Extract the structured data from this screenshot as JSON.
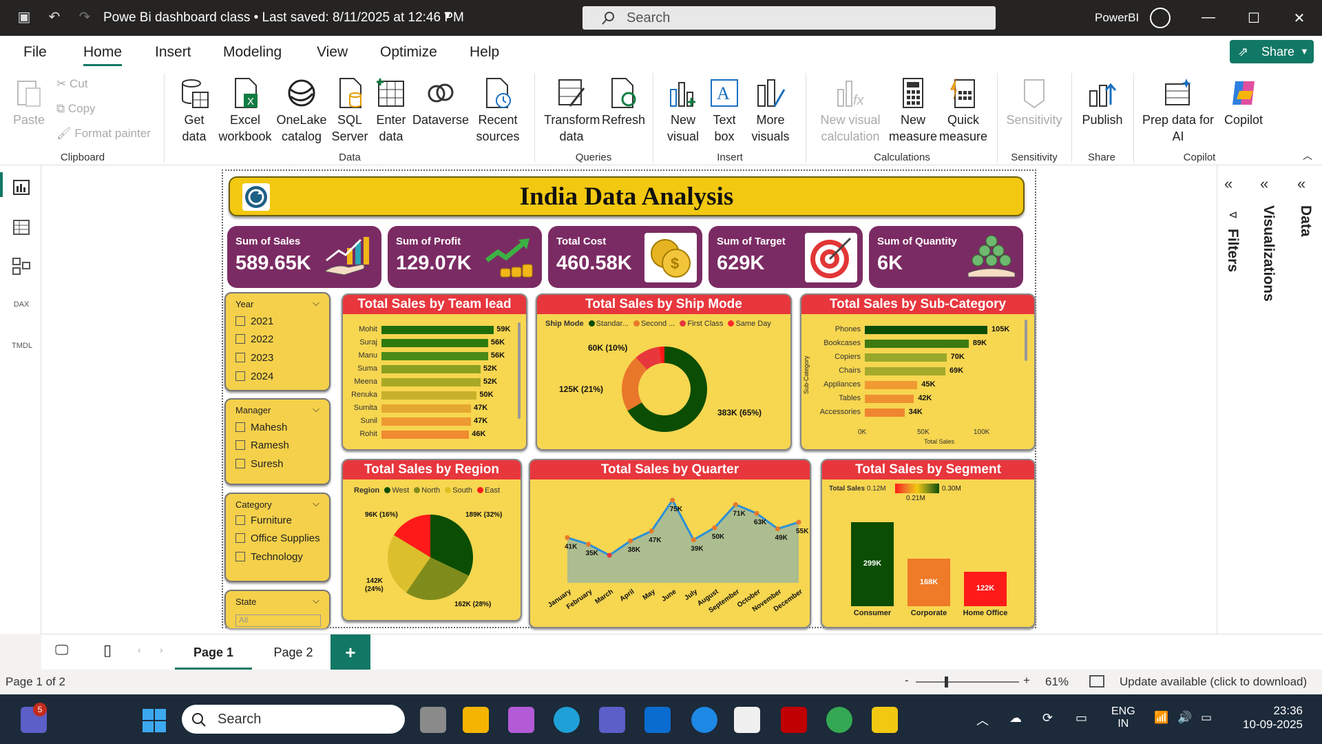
{
  "titlebar": {
    "doc_title": "Powe Bi dashboard class • Last saved: 8/11/2025 at 12:46 PM",
    "search_placeholder": "Search",
    "app_name": "PowerBI"
  },
  "menu": {
    "file": "File",
    "home": "Home",
    "insert": "Insert",
    "modeling": "Modeling",
    "view": "View",
    "optimize": "Optimize",
    "help": "Help",
    "share": "Share"
  },
  "ribbon": {
    "clipboard": {
      "paste": "Paste",
      "cut": "Cut",
      "copy": "Copy",
      "format_painter": "Format painter",
      "group": "Clipboard"
    },
    "data": {
      "get_data": "Get data",
      "excel": "Excel workbook",
      "onelake": "OneLake catalog",
      "sql": "SQL Server",
      "enter": "Enter data",
      "dataverse": "Dataverse",
      "recent": "Recent sources",
      "group": "Data"
    },
    "queries": {
      "transform": "Transform data",
      "refresh": "Refresh",
      "group": "Queries"
    },
    "insert": {
      "new_visual": "New visual",
      "text_box": "Text box",
      "more_visuals": "More visuals",
      "group": "Insert"
    },
    "calculations": {
      "new_visual_calc": "New visual calculation",
      "new_measure": "New measure",
      "quick_measure": "Quick measure",
      "group": "Calculations"
    },
    "sensitivity": {
      "label": "Sensitivity",
      "group": "Sensitivity"
    },
    "share": {
      "publish": "Publish",
      "group": "Share"
    },
    "copilot": {
      "prep": "Prep data for AI",
      "copilot": "Copilot",
      "group": "Copilot"
    }
  },
  "report": {
    "title": "India Data Analysis",
    "kpis": [
      {
        "label": "Sum of Sales",
        "value": "589.65K"
      },
      {
        "label": "Sum of Profit",
        "value": "129.07K"
      },
      {
        "label": "Total Cost",
        "value": "460.58K"
      },
      {
        "label": "Sum of Target",
        "value": "629K"
      },
      {
        "label": "Sum of Quantity",
        "value": "6K"
      }
    ],
    "slicers": {
      "year": {
        "title": "Year",
        "options": [
          "2021",
          "2022",
          "2023",
          "2024"
        ]
      },
      "manager": {
        "title": "Manager",
        "options": [
          "Mahesh",
          "Ramesh",
          "Suresh"
        ]
      },
      "category": {
        "title": "Category",
        "options": [
          "Furniture",
          "Office Supplies",
          "Technology"
        ]
      },
      "state": {
        "title": "State",
        "value": "All"
      }
    },
    "team_lead": {
      "title": "Total Sales by Team lead",
      "rows": [
        {
          "name": "Mohit",
          "value": 59,
          "label": "59K",
          "color": "#1f6b0a"
        },
        {
          "name": "Suraj",
          "value": 56,
          "label": "56K",
          "color": "#2f7a10"
        },
        {
          "name": "Manu",
          "value": 56,
          "label": "56K",
          "color": "#4a8a18"
        },
        {
          "name": "Suma",
          "value": 52,
          "label": "52K",
          "color": "#8aa020"
        },
        {
          "name": "Meena",
          "value": 52,
          "label": "52K",
          "color": "#a9a824"
        },
        {
          "name": "Renuka",
          "value": 50,
          "label": "50K",
          "color": "#c8b02a"
        },
        {
          "name": "Sumita",
          "value": 47,
          "label": "47K",
          "color": "#e5a830"
        },
        {
          "name": "Sunil",
          "value": 47,
          "label": "47K",
          "color": "#ee9832"
        },
        {
          "name": "Rohit",
          "value": 46,
          "label": "46K",
          "color": "#f08a30"
        }
      ]
    },
    "ship_mode": {
      "title": "Total Sales by Ship Mode",
      "legend_title": "Ship Mode",
      "legend": [
        {
          "name": "Standar...",
          "color": "#0b4d02"
        },
        {
          "name": "Second ...",
          "color": "#e9772a"
        },
        {
          "name": "First Class",
          "color": "#e8363d"
        },
        {
          "name": "Same Day",
          "color": "#ff2a2a"
        }
      ],
      "slices": [
        {
          "value": 383,
          "color": "#0b4d02"
        },
        {
          "value": 125,
          "color": "#e9772a"
        },
        {
          "value": 55,
          "color": "#e8363d"
        },
        {
          "value": 12,
          "color": "#ff1a1a"
        }
      ],
      "labels": [
        "60K (10%)",
        "125K (21%)",
        "383K (65%)"
      ]
    },
    "sub_category": {
      "title": "Total Sales by Sub-Category",
      "axis_title": "Total Sales",
      "y_title": "Sub-Category",
      "ticks": [
        "0K",
        "50K",
        "100K"
      ],
      "rows": [
        {
          "name": "Phones",
          "value": 105,
          "label": "105K",
          "color": "#0b4d02"
        },
        {
          "name": "Bookcases",
          "value": 89,
          "label": "89K",
          "color": "#3d7a12"
        },
        {
          "name": "Copiers",
          "value": 70,
          "label": "70K",
          "color": "#98a82a"
        },
        {
          "name": "Chairs",
          "value": 69,
          "label": "69K",
          "color": "#a5aa2c"
        },
        {
          "name": "Appliances",
          "value": 45,
          "label": "45K",
          "color": "#ef9a32"
        },
        {
          "name": "Tables",
          "value": 42,
          "label": "42K",
          "color": "#ef9030"
        },
        {
          "name": "Accessories",
          "value": 34,
          "label": "34K",
          "color": "#ef8530"
        }
      ]
    },
    "region": {
      "title": "Total Sales by Region",
      "legend_title": "Region",
      "legend": [
        {
          "name": "West",
          "color": "#0b4d02"
        },
        {
          "name": "North",
          "color": "#7f8c1c"
        },
        {
          "name": "South",
          "color": "#e0c020"
        },
        {
          "name": "East",
          "color": "#ff1a1a"
        }
      ],
      "slices": [
        {
          "value": 189,
          "color": "#0b4d02"
        },
        {
          "value": 162,
          "color": "#7f8c1c"
        },
        {
          "value": 142,
          "color": "#dcbf2c"
        },
        {
          "value": 96,
          "color": "#ff1a1a"
        }
      ],
      "labels": [
        "189K (32%)",
        "162K (28%)",
        "142K",
        "(24%)",
        "96K (16%)"
      ]
    },
    "quarter": {
      "title": "Total Sales by Quarter",
      "months": [
        "January",
        "February",
        "March",
        "April",
        "May",
        "June",
        "July",
        "August",
        "September",
        "October",
        "November",
        "December"
      ],
      "values": [
        41,
        35,
        25,
        38,
        47,
        75,
        39,
        50,
        71,
        63,
        49,
        55
      ],
      "labels": [
        "41K",
        "35K",
        "",
        "38K",
        "47K",
        "75K",
        "39K",
        "50K",
        "71K",
        "63K",
        "49K",
        "55K"
      ]
    },
    "segment": {
      "title": "Total Sales by Segment",
      "legend_title": "Total Sales",
      "min_label": "0.12M",
      "mid_label": "0.21M",
      "max_label": "0.30M",
      "bars": [
        {
          "name": "Consumer",
          "value": 299,
          "label": "299K",
          "color": "#0b4d02"
        },
        {
          "name": "Corporate",
          "value": 168,
          "label": "168K",
          "color": "#ef7a28"
        },
        {
          "name": "Home Office",
          "value": 122,
          "label": "122K",
          "color": "#ff1a1a"
        }
      ]
    }
  },
  "panes": {
    "filters": "Filters",
    "visualizations": "Visualizations",
    "data": "Data"
  },
  "pages": {
    "page1": "Page 1",
    "page2": "Page 2",
    "add": "+"
  },
  "status": {
    "page": "Page 1 of 2",
    "zoom": "61%",
    "update": "Update available (click to download)"
  },
  "taskbar": {
    "search": "Search",
    "lang1": "ENG",
    "lang2": "IN",
    "time": "23:36",
    "date": "10-09-2025",
    "badge": "5"
  }
}
